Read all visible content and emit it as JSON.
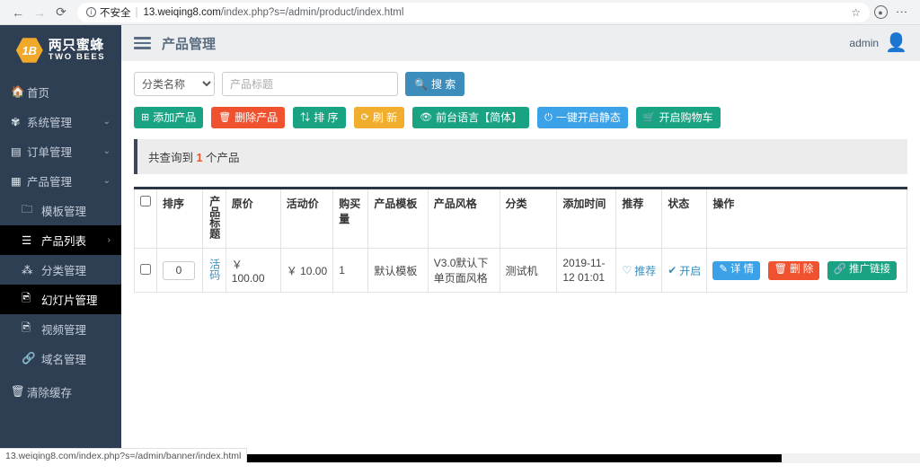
{
  "browser": {
    "back_icon": "←",
    "forward_icon": "→",
    "reload_icon": "⟳",
    "security_label": "不安全",
    "url_host": "13.weiqing8.com",
    "url_path": "/index.php?s=/admin/product/index.html",
    "star_icon": "☆",
    "profile_icon": "person-icon",
    "menu_icon": "⋮"
  },
  "sidebar": {
    "logo": {
      "mark": "1B",
      "cn": "两只蜜蜂",
      "en": "TWO BEES"
    },
    "items": [
      {
        "label": "首页",
        "icon": "🏠",
        "chevron": "",
        "state": "normal"
      },
      {
        "label": "系统管理",
        "icon": "✾",
        "chevron": "⌄",
        "state": "normal"
      },
      {
        "label": "订单管理",
        "icon": "▤",
        "chevron": "⌄",
        "state": "normal"
      },
      {
        "label": "产品管理",
        "icon": "▦",
        "chevron": "⌄",
        "state": "open"
      },
      {
        "label": "模板管理",
        "icon": "🗀",
        "chevron": "",
        "state": "sub"
      },
      {
        "label": "产品列表",
        "icon": "☰",
        "chevron": "›",
        "state": "active"
      },
      {
        "label": "分类管理",
        "icon": "⁂",
        "chevron": "",
        "state": "sub"
      },
      {
        "label": "幻灯片管理",
        "icon": "🖻",
        "chevron": "",
        "state": "active-sub"
      },
      {
        "label": "视频管理",
        "icon": "🖻",
        "chevron": "",
        "state": "sub"
      },
      {
        "label": "域名管理",
        "icon": "🔗",
        "chevron": "",
        "state": "sub"
      },
      {
        "label": "清除缓存",
        "icon": "🗑",
        "chevron": "",
        "state": "normal"
      }
    ]
  },
  "header": {
    "title": "产品管理",
    "user": "admin"
  },
  "search": {
    "select_value": "分类名称",
    "select_options": [
      "分类名称"
    ],
    "placeholder": "产品标题",
    "input_value": "",
    "button_label": "搜 索",
    "button_icon": "🔍"
  },
  "actions": [
    {
      "label": "添加产品",
      "icon": "⊞",
      "color": "#19a383"
    },
    {
      "label": "删除产品",
      "icon": "🗑",
      "color": "#f0522f"
    },
    {
      "label": "排 序",
      "icon": "⇅",
      "color": "#19a383"
    },
    {
      "label": "刷 新",
      "icon": "⟳",
      "color": "#f0ad2e"
    },
    {
      "label": "前台语言【简体】",
      "icon": "👁",
      "color": "#19a383"
    },
    {
      "label": "一键开启静态",
      "icon": "⏻",
      "color": "#3ca2e8"
    },
    {
      "label": "开启购物车",
      "icon": "🛒",
      "color": "#19a383"
    }
  ],
  "alert": {
    "prefix": "共查询到",
    "count": "1",
    "suffix": "个产品"
  },
  "table": {
    "columns": [
      "",
      "排序",
      "产品标题",
      "原价",
      "活动价",
      "购买量",
      "产品模板",
      "产品风格",
      "分类",
      "添加时间",
      "推荐",
      "状态",
      "操作"
    ],
    "rows": [
      {
        "sort_value": "0",
        "title": "活码",
        "price": "￥ 100.00",
        "act_price": "￥ 10.00",
        "buy_count": "1",
        "template": "默认模板",
        "style": "V3.0默认下单页面风格",
        "category": "测试机",
        "time": "2019-11-12 01:01",
        "recommend": "推荐",
        "recommend_icon": "♡",
        "status": "开启",
        "status_icon": "✔",
        "ops": [
          {
            "label": "详 情",
            "icon": "✎",
            "color": "#3ca2e8"
          },
          {
            "label": "删 除",
            "icon": "🗑",
            "color": "#f0522f"
          },
          {
            "label": "推广链接",
            "icon": "🔗",
            "color": "#19a383"
          }
        ]
      }
    ]
  },
  "statusbar": {
    "text": "13.weiqing8.com/index.php?s=/admin/banner/index.html"
  }
}
